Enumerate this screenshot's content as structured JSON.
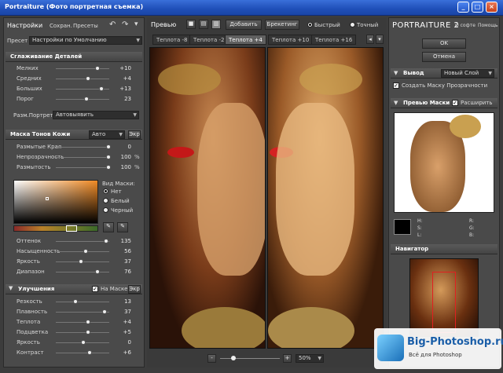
{
  "window": {
    "title": "Portraiture (Фото портретная съемка)"
  },
  "left": {
    "settings_label": "Настройки",
    "save_label": "Сохран.",
    "presets_label": "Пресеты",
    "preset_label": "Пресет",
    "preset_value": "Настройки по Умолчанию",
    "smoothing": {
      "title": "Сглаживание Деталей",
      "rows": [
        {
          "label": "Мелких",
          "value": "+10",
          "level": 0.78
        },
        {
          "label": "Средних",
          "value": "+4",
          "level": 0.6
        },
        {
          "label": "Больших",
          "value": "+13",
          "level": 0.86
        },
        {
          "label": "Порог",
          "value": "23",
          "level": 0.57
        }
      ]
    },
    "portrait_size_label": "Разм.Портрет",
    "portrait_size_value": "Автовыявить",
    "skin_mask": {
      "title": "Маска Тонов Кожи",
      "mode": "Авто",
      "show_label": "Экр",
      "rows": [
        {
          "label": "Размытые Края",
          "value": "0",
          "unit": "",
          "level": 1.0
        },
        {
          "label": "Непрозрачность",
          "value": "100",
          "unit": "%",
          "level": 1.0
        },
        {
          "label": "Размытость",
          "value": "100",
          "unit": "%",
          "level": 1.0
        }
      ],
      "view_label": "Вид Маски:",
      "view_options": [
        {
          "label": "Нет",
          "on": true
        },
        {
          "label": "Белый",
          "on": false
        },
        {
          "label": "Черный",
          "on": false
        }
      ],
      "hsl_rows": [
        {
          "label": "Оттенок",
          "value": "135",
          "level": 0.95
        },
        {
          "label": "Насыщенность",
          "value": "56",
          "level": 0.55
        },
        {
          "label": "Яркость",
          "value": "37",
          "level": 0.45
        },
        {
          "label": "Диапазон",
          "value": "76",
          "level": 0.78
        }
      ]
    },
    "enhance": {
      "title": "Улучшения",
      "on_mask_label": "На Маске",
      "show_label": "Экр",
      "rows": [
        {
          "label": "Резкость",
          "value": "13",
          "unit": "",
          "level": 0.35
        },
        {
          "label": "Плавность",
          "value": "37",
          "unit": "",
          "level": 0.92
        },
        {
          "label": "Теплота",
          "value": "+4",
          "unit": "",
          "level": 0.6
        },
        {
          "label": "Подцветка",
          "value": "+5",
          "unit": "",
          "level": 0.6
        },
        {
          "label": "Яркость",
          "value": "0",
          "unit": "",
          "level": 0.5
        },
        {
          "label": "Контраст",
          "value": "+6",
          "unit": "",
          "level": 0.62
        }
      ]
    }
  },
  "preview": {
    "label": "Превью",
    "add_label": "Добавить",
    "bracket_label": "Брекетинг",
    "fast_label": "Быстрый",
    "exact_label": "Точный",
    "tabs": [
      "Теплота -8",
      "Теплота -2",
      "Теплота +4",
      "Теплота +10",
      "Теплота +16"
    ],
    "zoom": "50%",
    "zoom_minus": "-",
    "zoom_plus": "+"
  },
  "right": {
    "brand": "PORTRAITURE",
    "brand_version": "2",
    "about": "О софте",
    "help": "Помощь",
    "ok_label": "OK",
    "cancel_label": "Отмена",
    "output": {
      "title": "Вывод",
      "mode": "Новый Слой",
      "create_mask_label": "Создать Маску Прозрачности"
    },
    "mask_preview": {
      "title": "Превью Маски",
      "expand_label": "Расширить",
      "readout": {
        "h": "H:",
        "s": "S:",
        "l": "L:",
        "r": "R:",
        "g": "G:",
        "b": "B:"
      }
    },
    "navigator": {
      "title": "Навигатор"
    }
  },
  "watermark": {
    "site": "Big-Photoshop.ru",
    "tagline": "Всё для Photoshop"
  }
}
